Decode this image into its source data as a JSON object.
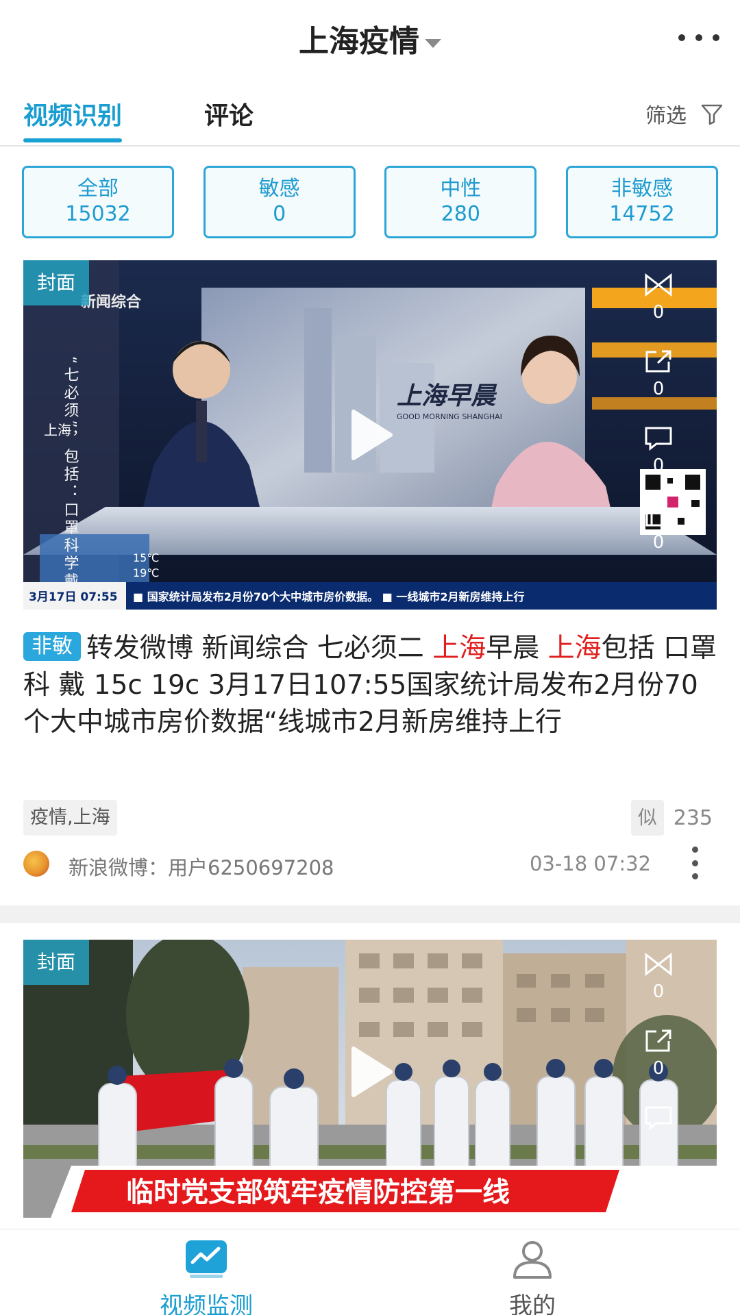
{
  "header": {
    "title": "上海疫情",
    "more_icon": "more-horizontal-icon"
  },
  "tabs": [
    {
      "label": "视频识别",
      "active": true
    },
    {
      "label": "评论",
      "active": false
    }
  ],
  "filter": {
    "label": "筛选",
    "icon": "filter-funnel-icon"
  },
  "summary": [
    {
      "label": "全部",
      "count": "15032"
    },
    {
      "label": "敏感",
      "count": "0"
    },
    {
      "label": "中性",
      "count": "280"
    },
    {
      "label": "非敏感",
      "count": "14752"
    }
  ],
  "cards": [
    {
      "cover_label": "封面",
      "side_counts": {
        "favorite": "0",
        "share": "0",
        "comment": "0",
        "like": "0"
      },
      "sentiment_tag": "非敏",
      "description_parts": {
        "p1": "转发微博 新闻综合 七必须二 ",
        "hl1": "上海",
        "p2": "早晨 ",
        "hl2": "上海",
        "p3": "包括 口罩科 戴 15c 19c 3月17日107:55国家统计局发布2月份70个大中城市房价数据“线城市2月新房维持上行"
      },
      "tags": "疫情,上海",
      "similar_label": "似",
      "similar_count": "235",
      "source": "新浪微博：用户6250697208",
      "time": "03-18 07:32",
      "thumb_text": {
        "channel": "新闻综合",
        "show_title": "上海早晨",
        "show_sub": "GOOD MORNING SHANGHAI",
        "side_caption": "“七必须”，包括：口罩科学戴",
        "city": "上海",
        "temp_high": "15℃",
        "temp_low": "19℃",
        "date_time": "3月17日 07:55",
        "ticker": "■ 国家统计局发布2月份70个大中城市房价数据。  ■ 一线城市2月新房维持上行"
      }
    },
    {
      "cover_label": "封面",
      "side_counts": {
        "favorite": "0",
        "share": "0"
      },
      "banner": "临时党支部筑牢疫情防控第一线"
    }
  ],
  "bottom_nav": [
    {
      "label": "视频监测",
      "icon": "chart-trend-icon",
      "active": true
    },
    {
      "label": "我的",
      "icon": "user-profile-icon",
      "active": false
    }
  ],
  "colors": {
    "accent": "#1a9dd1",
    "highlight": "#e01e1e",
    "tag_bg": "#2aa7dc"
  }
}
